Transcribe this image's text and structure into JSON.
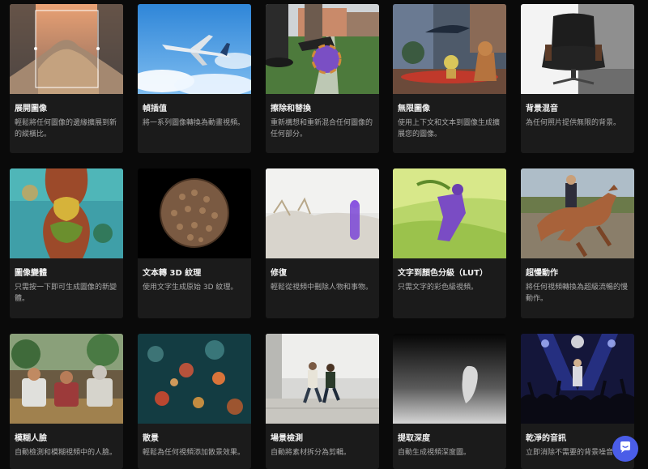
{
  "tools": [
    {
      "title": "展開圖像",
      "description": "輕鬆將任何圖像的邊緣擴展到新的縱橫比。",
      "icon": "image-expand-thumbnail"
    },
    {
      "title": "幀插值",
      "description": "將一系列圖像轉換為動畫視頻。",
      "icon": "airplane-thumbnail"
    },
    {
      "title": "擦除和替換",
      "description": "重新構想和重新混合任何圖像的任何部分。",
      "icon": "soccer-ball-thumbnail"
    },
    {
      "title": "無限圖像",
      "description": "使用上下文和文本到圖像生成擴展您的圖像。",
      "icon": "surreal-scene-thumbnail"
    },
    {
      "title": "背景混音",
      "description": "為任何照片提供無限的背景。",
      "icon": "lounge-chair-thumbnail"
    },
    {
      "title": "圖像變體",
      "description": "只需按一下即可生成圖像的新變體。",
      "icon": "painted-vase-thumbnail"
    },
    {
      "title": "文本轉 3D 紋理",
      "description": "使用文字生成原始 3D 紋理。",
      "icon": "textured-sphere-thumbnail"
    },
    {
      "title": "修復",
      "description": "輕鬆從視頻中刪除人物和事物。",
      "icon": "beach-thumbnail"
    },
    {
      "title": "文字到顏色分級（LUT）",
      "description": "只需文字的彩色級視頻。",
      "icon": "color-grade-thumbnail"
    },
    {
      "title": "超慢動作",
      "description": "將任何視頻轉換為超級流暢的慢動作。",
      "icon": "horse-rider-thumbnail"
    },
    {
      "title": "模糊人臉",
      "description": "自動檢測和模糊視頻中的人臉。",
      "icon": "family-scene-thumbnail"
    },
    {
      "title": "散景",
      "description": "輕鬆為任何視頻添加散景效果。",
      "icon": "bokeh-lights-thumbnail"
    },
    {
      "title": "場景檢測",
      "description": "自動將素材拆分為剪輯。",
      "icon": "street-runners-thumbnail"
    },
    {
      "title": "提取深度",
      "description": "自動生成視頻深度圖。",
      "icon": "depth-map-thumbnail"
    },
    {
      "title": "乾淨的音訊",
      "description": "立即消除不需要的背景噪音。",
      "icon": "concert-crowd-thumbnail"
    }
  ],
  "chat_button": {
    "icon": "chat-bubble-icon",
    "color": "#4a5de8"
  }
}
